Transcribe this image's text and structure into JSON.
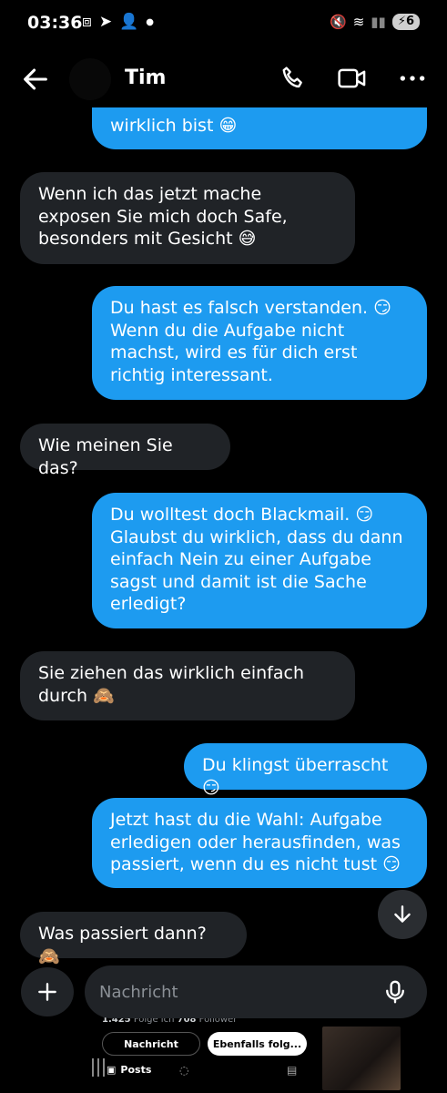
{
  "status_bar": {
    "time": "03:36",
    "battery": "6"
  },
  "header": {
    "contact_name": "Tim"
  },
  "messages": [
    {
      "dir": "out",
      "text": "wirklich bist 😁"
    },
    {
      "dir": "in",
      "text": "Wenn ich das jetzt mache exposen Sie mich doch Safe, besonders mit Gesicht 😅"
    },
    {
      "dir": "out",
      "text": "Du hast es falsch verstanden. 😏 Wenn du die Aufgabe nicht machst, wird es für dich erst richtig interessant."
    },
    {
      "dir": "in",
      "text": "Wie meinen Sie das?"
    },
    {
      "dir": "out",
      "text": "Du wolltest doch Blackmail. 😏 Glaubst du wirklich, dass du dann einfach Nein zu einer Aufgabe sagst und damit ist die Sache erledigt?"
    },
    {
      "dir": "in",
      "text": "Sie ziehen das wirklich einfach durch 🙈"
    },
    {
      "dir": "out",
      "text": "Du klingst überrascht 😏"
    },
    {
      "dir": "out",
      "text": "Jetzt hast du die Wahl: Aufgabe erledigen oder herausfinden, was passiert, wenn du es nicht tust 😏"
    },
    {
      "dir": "in",
      "text": "Was passiert dann? 🙈"
    }
  ],
  "composer": {
    "placeholder": "Nachricht"
  },
  "background_profile": {
    "following_count": "1.425",
    "following_label": "Folge ich",
    "followers_count": "708",
    "followers_label": "Follower",
    "message_button": "Nachricht",
    "follow_back_button": "Ebenfalls folg...",
    "posts_tab": "Posts"
  }
}
